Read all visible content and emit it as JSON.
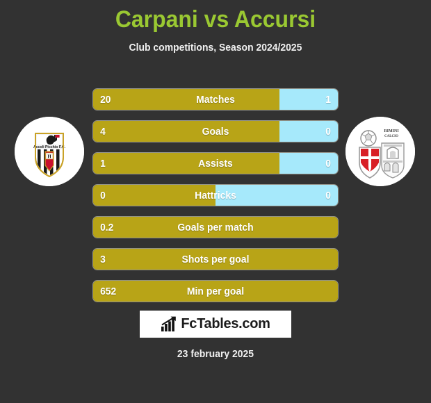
{
  "header": {
    "title": "Carpani vs Accursi",
    "subtitle": "Club competitions, Season 2024/2025",
    "title_color": "#9ac832"
  },
  "teams": {
    "left": {
      "crest_name": "ascoli-picchio-fc-crest",
      "crest_caption": "Ascoli Picchio F.C."
    },
    "right": {
      "crest_name": "rimini-calcio-crest",
      "crest_caption": "Rimini Calcio"
    }
  },
  "colors": {
    "background": "#323232",
    "bar_left": "#b8a417",
    "bar_right": "#a6e9fb",
    "text": "#ffffff",
    "accent": "#9ac832"
  },
  "stats": [
    {
      "label": "Matches",
      "left_value": "20",
      "right_value": "1",
      "left_percent": 76,
      "has_right": true
    },
    {
      "label": "Goals",
      "left_value": "4",
      "right_value": "0",
      "left_percent": 76,
      "has_right": true
    },
    {
      "label": "Assists",
      "left_value": "1",
      "right_value": "0",
      "left_percent": 76,
      "has_right": true
    },
    {
      "label": "Hattricks",
      "left_value": "0",
      "right_value": "0",
      "left_percent": 50,
      "has_right": true
    },
    {
      "label": "Goals per match",
      "left_value": "0.2",
      "right_value": "",
      "left_percent": 100,
      "has_right": false
    },
    {
      "label": "Shots per goal",
      "left_value": "3",
      "right_value": "",
      "left_percent": 100,
      "has_right": false
    },
    {
      "label": "Min per goal",
      "left_value": "652",
      "right_value": "",
      "left_percent": 100,
      "has_right": false
    }
  ],
  "footer": {
    "brand_text": "FcTables.com",
    "brand_icon": "bar-chart-growth-icon",
    "date": "23 february 2025"
  }
}
